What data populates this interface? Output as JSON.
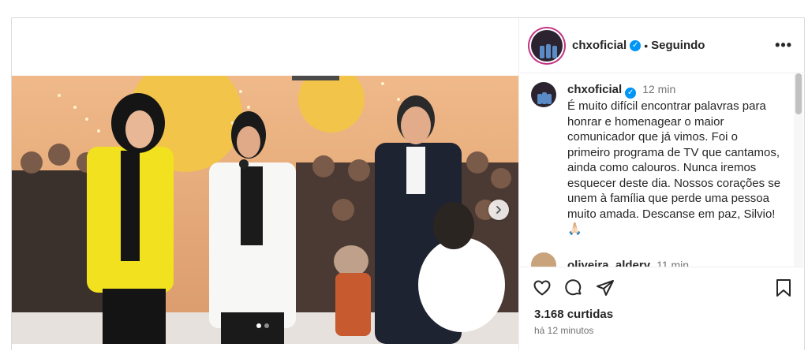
{
  "post": {
    "username": "chxoficial",
    "follow_status": "Seguindo",
    "more_label": "•••",
    "separator": "•"
  },
  "caption": {
    "username": "chxoficial",
    "time": "12 min",
    "text": "É muito difícil encontrar palavras para honrar e homenagear o maior comunicador que já vimos. Foi o primeiro programa de TV que cantamos, ainda como calouros. Nunca iremos esquecer deste dia. Nossos corações se unem à família que perde uma pessoa muito amada. Descanse em paz, Silvio! 🙏🏻"
  },
  "comments": [
    {
      "username": "oliveira_aldery",
      "time": "11 min"
    }
  ],
  "footer": {
    "likes": "3.168 curtidas",
    "posted": "há 12 minutos"
  },
  "carousel": {
    "current": 1,
    "total": 2
  },
  "icons": [
    "heart-icon",
    "comment-icon",
    "share-icon",
    "bookmark-icon",
    "chevron-right-icon",
    "verified-icon"
  ],
  "colors": {
    "verified": "#0095f6",
    "text": "#262626",
    "muted": "#737373",
    "story_ring": "#c13584"
  }
}
